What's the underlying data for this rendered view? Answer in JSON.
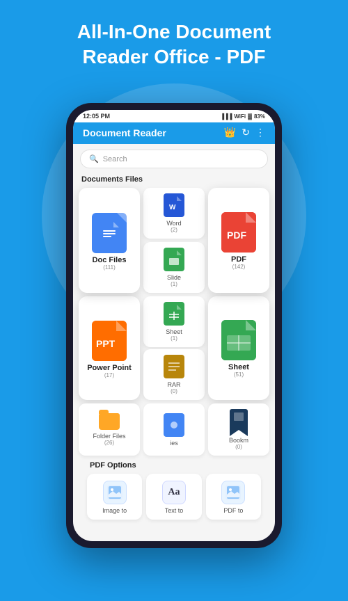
{
  "header": {
    "title": "All-In-One Document\nReader Office - PDF",
    "bg_color": "#1a9be8"
  },
  "status_bar": {
    "time": "12:05 PM",
    "battery": "83%"
  },
  "app_bar": {
    "title": "Document Reader",
    "crown_icon": "👑",
    "refresh_icon": "↻",
    "more_icon": "⋮"
  },
  "search": {
    "placeholder": "Search"
  },
  "sections": {
    "documents": {
      "title": "Documents Files",
      "items": [
        {
          "name": "Doc Files",
          "count": "(111)",
          "type": "doc",
          "size": "large"
        },
        {
          "name": "Word",
          "count": "(2)",
          "type": "word",
          "size": "small"
        },
        {
          "name": "PDF",
          "count": "(142)",
          "type": "pdf",
          "size": "large"
        },
        {
          "name": "Slide",
          "count": "(1)",
          "type": "slide",
          "size": "small"
        },
        {
          "name": "Sheet",
          "count": "(1)",
          "type": "sheet-small",
          "size": "small"
        },
        {
          "name": "Power Point",
          "count": "(17)",
          "type": "ppt",
          "size": "large"
        },
        {
          "name": "RAR",
          "count": "(0)",
          "type": "rar",
          "size": "small"
        },
        {
          "name": "Sheet",
          "count": "(51)",
          "type": "sheet-large",
          "size": "large"
        },
        {
          "name": "Folder Files",
          "count": "(26)",
          "type": "folder",
          "size": "small"
        },
        {
          "name": "ies",
          "count": "",
          "type": "ies",
          "size": "small"
        },
        {
          "name": "Bookm",
          "count": "(0)",
          "type": "bookmark",
          "size": "small"
        }
      ]
    },
    "pdf_options": {
      "title": "PDF Options",
      "items": [
        {
          "name": "Image to",
          "type": "image",
          "icon": "🖼"
        },
        {
          "name": "Text to",
          "type": "text",
          "icon": "Aa"
        },
        {
          "name": "PDF to",
          "type": "convert",
          "icon": "🖼"
        }
      ]
    }
  }
}
